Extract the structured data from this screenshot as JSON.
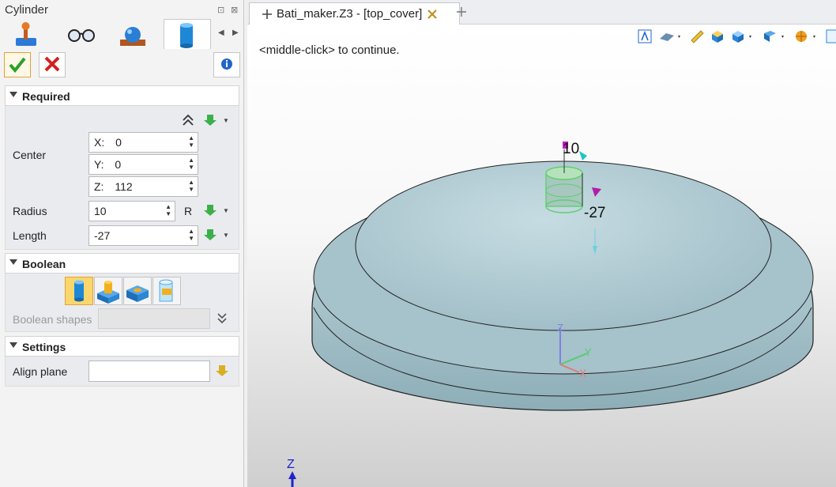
{
  "panel": {
    "title": "Cylinder",
    "sections": {
      "required": "Required",
      "boolean": "Boolean",
      "settings": "Settings"
    },
    "center_label": "Center",
    "x_label": "X:",
    "x_value": "0",
    "y_label": "Y:",
    "y_value": "0",
    "z_label": "Z:",
    "z_value": "112",
    "radius_label": "Radius",
    "radius_value": "10",
    "radius_suffix": "R",
    "length_label": "Length",
    "length_value": "-27",
    "boolean_shapes_label": "Boolean shapes",
    "align_plane_label": "Align plane"
  },
  "document": {
    "tab_title": "Bati_maker.Z3 - [top_cover]",
    "hint": "<middle-click> to continue."
  },
  "viewport": {
    "dim_radius": "10",
    "dim_length": "-27",
    "axis_z": "Z",
    "axis_y": "Y",
    "axis_x": "X",
    "corner_z": "Z"
  },
  "colors": {
    "accent": "#e2a33a",
    "body": "#a9c3cb",
    "preview": "#7ce08c"
  }
}
